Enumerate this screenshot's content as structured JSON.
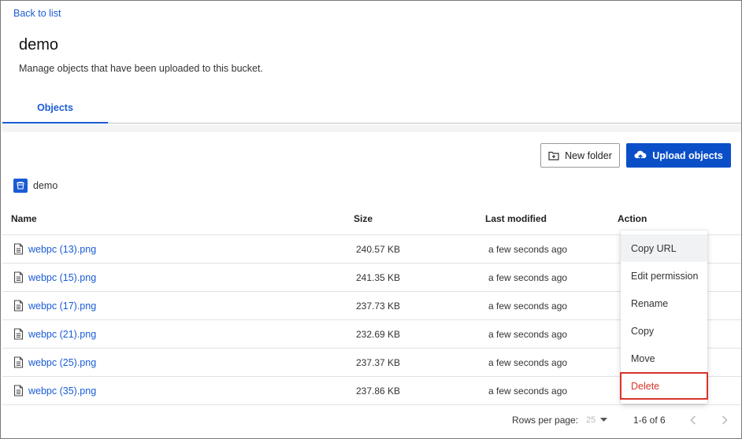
{
  "nav": {
    "back_label": "Back to list"
  },
  "header": {
    "title": "demo",
    "subtitle": "Manage objects that have been uploaded to this bucket."
  },
  "tabs": [
    {
      "label": "Objects",
      "active": true
    }
  ],
  "toolbar": {
    "new_folder_label": "New folder",
    "upload_label": "Upload objects"
  },
  "breadcrumb": {
    "bucket": "demo"
  },
  "table": {
    "columns": [
      "Name",
      "Size",
      "Last modified",
      "Action"
    ],
    "rows": [
      {
        "name": "webpc (13).png",
        "size": "240.57 KB",
        "modified": "a few seconds ago"
      },
      {
        "name": "webpc (15).png",
        "size": "241.35 KB",
        "modified": "a few seconds ago"
      },
      {
        "name": "webpc (17).png",
        "size": "237.73 KB",
        "modified": "a few seconds ago"
      },
      {
        "name": "webpc (21).png",
        "size": "232.69 KB",
        "modified": "a few seconds ago"
      },
      {
        "name": "webpc (25).png",
        "size": "237.37 KB",
        "modified": "a few seconds ago"
      },
      {
        "name": "webpc (35).png",
        "size": "237.86 KB",
        "modified": "a few seconds ago"
      }
    ]
  },
  "action_menu": {
    "items": [
      "Copy URL",
      "Edit permission",
      "Rename",
      "Copy",
      "Move",
      "Delete"
    ],
    "highlighted": "Delete"
  },
  "pagination": {
    "rows_per_page_label": "Rows per page:",
    "rows_per_page_value": "25",
    "range": "1-6 of 6"
  },
  "colors": {
    "accent": "#0b4fc8",
    "link": "#1a5bd6",
    "danger": "#d9342b"
  },
  "icons": {
    "file": "file-text-icon",
    "upload": "cloud-upload-icon",
    "folder": "folder-plus-icon",
    "bucket": "bucket-icon",
    "prev": "chevron-left-icon",
    "next": "chevron-right-icon",
    "dropdown": "caret-down-icon"
  }
}
